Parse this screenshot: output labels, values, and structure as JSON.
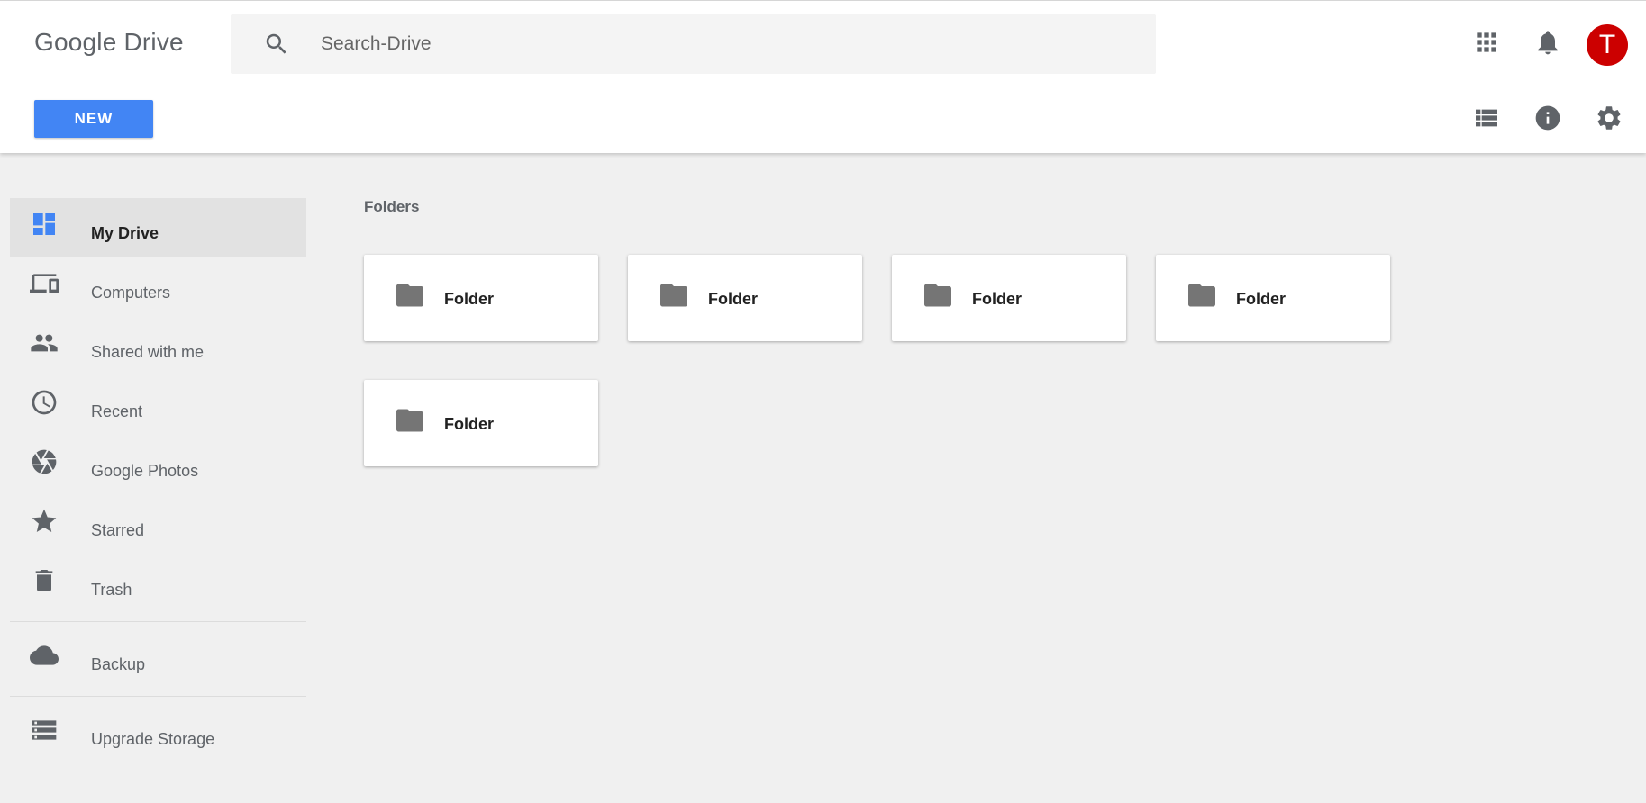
{
  "header": {
    "logo": "Google Drive",
    "search_placeholder": "Search-Drive",
    "avatar_letter": "T",
    "new_label": "NEW"
  },
  "colors": {
    "accent": "#4285f4",
    "avatar": "#cc0000",
    "my_drive_icon": "#4285f4",
    "icon_gray": "#5f6368"
  },
  "sidebar": {
    "items": [
      {
        "label": "My Drive",
        "icon": "my-drive-icon"
      },
      {
        "label": "Computers",
        "icon": "computers-icon"
      },
      {
        "label": "Shared with me",
        "icon": "people-icon"
      },
      {
        "label": "Recent",
        "icon": "clock-icon"
      },
      {
        "label": "Google Photos",
        "icon": "photos-icon"
      },
      {
        "label": "Starred",
        "icon": "star-icon"
      },
      {
        "label": "Trash",
        "icon": "trash-icon"
      },
      {
        "label": "Backup",
        "icon": "cloud-icon"
      },
      {
        "label": "Upgrade Storage",
        "icon": "storage-icon"
      }
    ]
  },
  "main": {
    "section_title": "Folders",
    "folders": [
      {
        "name": "Folder"
      },
      {
        "name": "Folder"
      },
      {
        "name": "Folder"
      },
      {
        "name": "Folder"
      },
      {
        "name": "Folder"
      }
    ]
  }
}
